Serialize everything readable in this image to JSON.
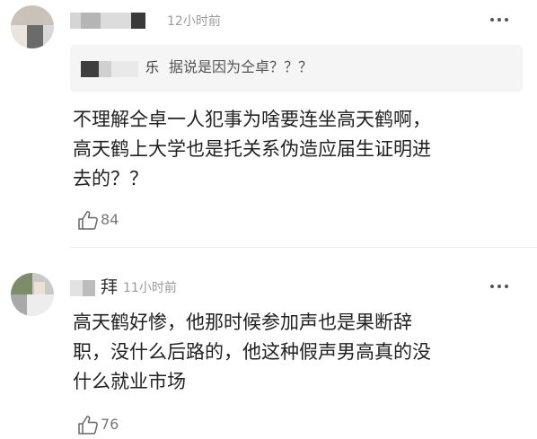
{
  "comments": [
    {
      "time": "12小时前",
      "reply_to": {
        "name_fragment": "乐",
        "text": "据说是因为仝卓？？？"
      },
      "lines": [
        "不理解仝卓一人犯事为啥要连坐高天鹤啊，",
        "高天鹤上大学也是托关系伪造应届生证明进",
        "去的？？"
      ],
      "likes": "84"
    },
    {
      "name_fragment": "拜",
      "time": "11小时前",
      "lines": [
        "高天鹤好惨，他那时候参加声也是果断辞",
        "职，没什么后路的，他这种假声男高真的没",
        "什么就业市场"
      ],
      "likes": "76"
    }
  ]
}
